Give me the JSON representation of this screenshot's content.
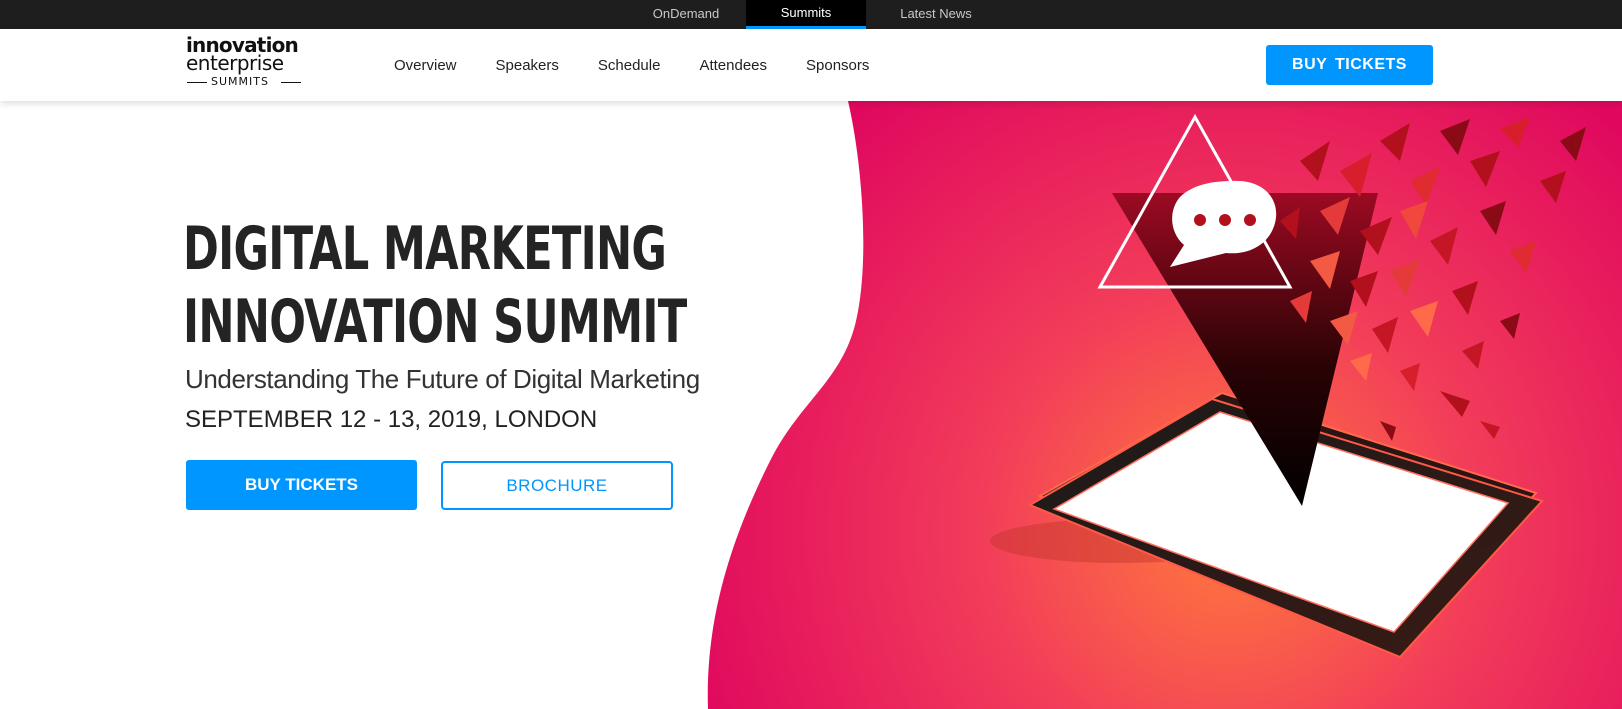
{
  "topbar": {
    "items": [
      {
        "label": "OnDemand",
        "active": false
      },
      {
        "label": "Summits",
        "active": true
      },
      {
        "label": "Latest News",
        "active": false
      }
    ]
  },
  "header": {
    "logo": {
      "line1": "innovation",
      "line2": "enterprise",
      "line3": "SUMMITS"
    },
    "nav": [
      "Overview",
      "Speakers",
      "Schedule",
      "Attendees",
      "Sponsors"
    ],
    "buy_label": "BUY  TICKETS"
  },
  "hero": {
    "title_line1": "DIGITAL MARKETING",
    "title_line2": "INNOVATION SUMMIT",
    "subtitle": "Understanding The Future of Digital Marketing",
    "date": "SEPTEMBER 12 - 13, 2019, LONDON",
    "buy_label": "BUY TICKETS",
    "brochure_label": "BROCHURE",
    "illustration": "tablet-with-shattering-triangle-and-chat-bubble"
  },
  "colors": {
    "accent": "#0096ff",
    "topbar_bg": "#1e1e1e",
    "hero_pink": "#e4105a",
    "hero_orange": "#ff6a3a",
    "text_dark": "#242424"
  }
}
